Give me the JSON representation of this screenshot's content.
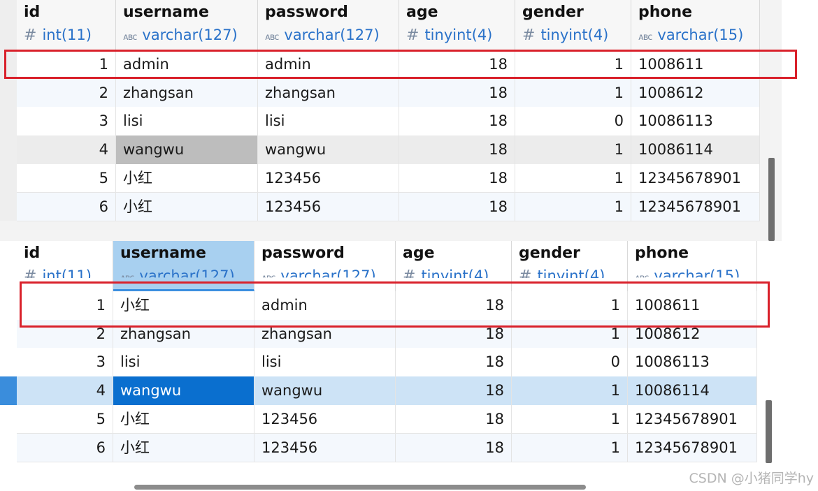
{
  "columns": [
    {
      "name": "id",
      "type": "int(11)",
      "icon": "hash-icon"
    },
    {
      "name": "username",
      "type": "varchar(127)",
      "icon": "text-type-icon"
    },
    {
      "name": "password",
      "type": "varchar(127)",
      "icon": "text-type-icon"
    },
    {
      "name": "age",
      "type": "tinyint(4)",
      "icon": "hash-icon"
    },
    {
      "name": "gender",
      "type": "tinyint(4)",
      "icon": "hash-icon"
    },
    {
      "name": "phone",
      "type": "varchar(15)",
      "icon": "text-type-icon"
    }
  ],
  "icons": {
    "hash": "#",
    "text": "ᴀʙᴄ"
  },
  "before": {
    "rows": [
      [
        "1",
        "admin",
        "admin",
        "18",
        "1",
        "1008611"
      ],
      [
        "2",
        "zhangsan",
        "zhangsan",
        "18",
        "1",
        "1008612"
      ],
      [
        "3",
        "lisi",
        "lisi",
        "18",
        "0",
        "10086113"
      ],
      [
        "4",
        "wangwu",
        "wangwu",
        "18",
        "1",
        "10086114"
      ],
      [
        "5",
        "小红",
        "123456",
        "18",
        "1",
        "12345678901"
      ],
      [
        "6",
        "小红",
        "123456",
        "18",
        "1",
        "12345678901"
      ]
    ]
  },
  "after": {
    "rows": [
      [
        "1",
        "小红",
        "admin",
        "18",
        "1",
        "1008611"
      ],
      [
        "2",
        "zhangsan",
        "zhangsan",
        "18",
        "1",
        "1008612"
      ],
      [
        "3",
        "lisi",
        "lisi",
        "18",
        "0",
        "10086113"
      ],
      [
        "4",
        "wangwu",
        "wangwu",
        "18",
        "1",
        "10086114"
      ],
      [
        "5",
        "小红",
        "123456",
        "18",
        "1",
        "12345678901"
      ],
      [
        "6",
        "小红",
        "123456",
        "18",
        "1",
        "12345678901"
      ]
    ]
  },
  "colors": {
    "highlight_box": "#d9212b",
    "selected_cell": "#0a6fcf",
    "selected_row": "#cde3f6",
    "header_selected": "#a8d0f0"
  },
  "watermark": "CSDN @小猪同学hy"
}
